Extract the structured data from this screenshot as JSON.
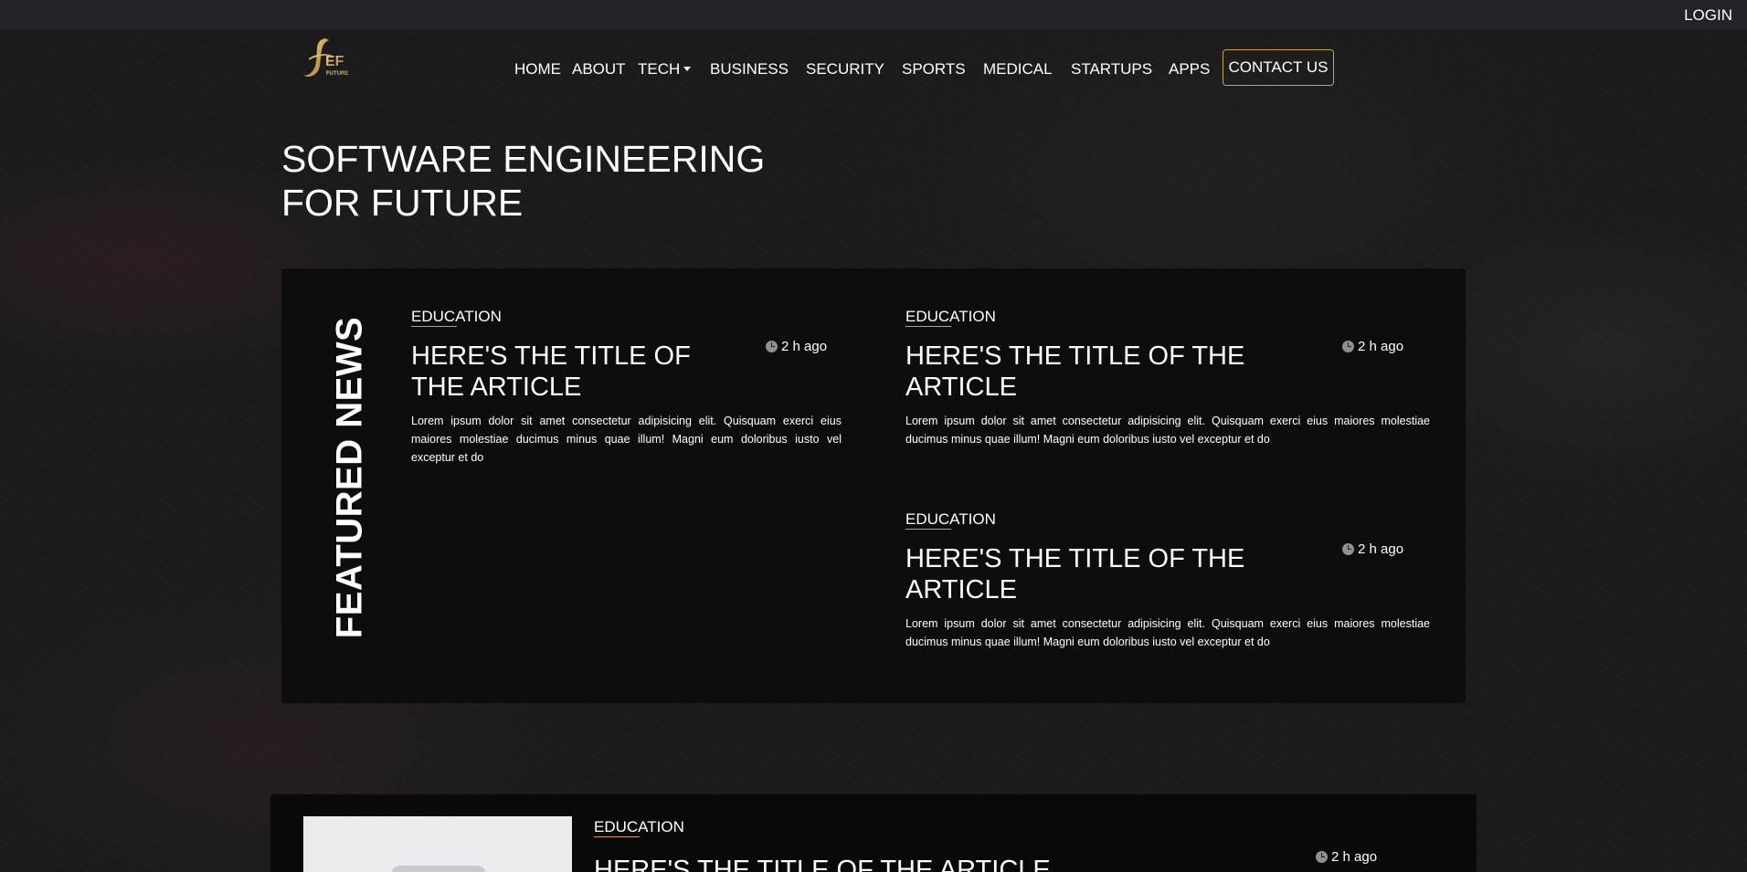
{
  "header": {
    "login_label": "LOGIN",
    "logo_text": "EF",
    "logo_subtext": "FUTURE"
  },
  "nav": {
    "items": [
      "HOME",
      "ABOUT",
      "TECH",
      "BUSINESS",
      "SECURITY",
      "SPORTS",
      "MEDICAL",
      "STARTUPS",
      "APPS"
    ],
    "contact_label": "CONTACT US"
  },
  "hero": {
    "title_line1": "SOFTWARE ENGINEERING",
    "title_line2": "FOR FUTURE"
  },
  "featured": {
    "label": "FEATURED NEWS",
    "articles": [
      {
        "category": "EDUCATION",
        "title_line1": "HERE'S THE TITLE OF",
        "title_line2": "THE ARTICLE",
        "time": "2 h ago",
        "excerpt": "Lorem ipsum dolor sit amet consectetur adipisicing elit. Quisquam exerci eius maiores molestiae ducimus minus quae illum! Magni eum doloribus iusto vel exceptur et do"
      },
      {
        "category": "EDUCATION",
        "title_line1": "HERE'S THE TITLE OF THE",
        "title_line2": "ARTICLE",
        "time": "2 h ago",
        "excerpt": "Lorem ipsum dolor sit amet consectetur adipisicing elit. Quisquam exerci eius maiores molestiae ducimus minus quae illum! Magni eum doloribus iusto vel exceptur et do"
      },
      {
        "category": "EDUCATION",
        "title_line1": "HERE'S THE TITLE OF THE",
        "title_line2": "ARTICLE",
        "time": "2 h ago",
        "excerpt": "Lorem ipsum dolor sit amet consectetur adipisicing elit. Quisquam exerci eius maiores molestiae ducimus minus quae illum! Magni eum doloribus iusto vel exceptur et do"
      }
    ]
  },
  "list_article": {
    "category": "EDUCATION",
    "title": "HERE'S THE TITLE OF THE ARTICLE",
    "time": "2 h ago"
  },
  "colors": {
    "accent": "#c9a24c",
    "topbar": "#212429",
    "panel": "#0a0a0a"
  }
}
